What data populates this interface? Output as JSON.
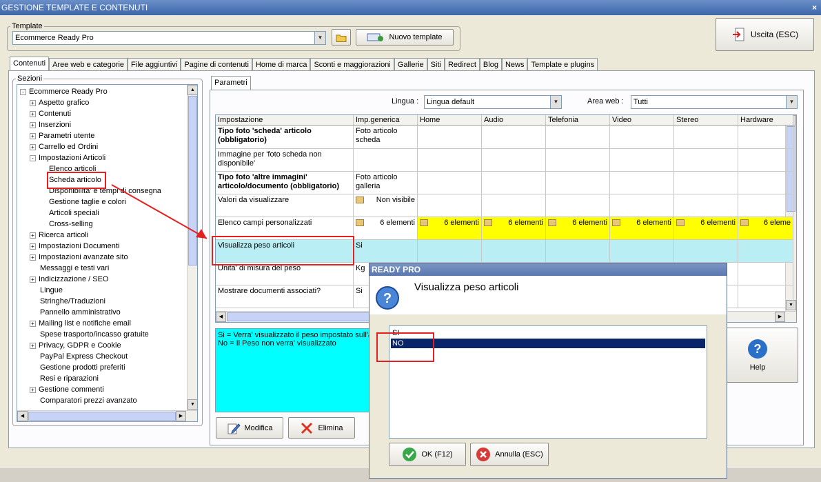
{
  "window": {
    "title": "GESTIONE TEMPLATE E CONTENUTI",
    "close_glyph": "×"
  },
  "template": {
    "group_label": "Template",
    "selected": "Ecommerce Ready Pro",
    "new_button": "Nuovo template"
  },
  "exit_button": "Uscita (ESC)",
  "tabs": [
    "Contenuti",
    "Aree web e categorie",
    "File aggiuntivi",
    "Pagine di contenuti",
    "Home di marca",
    "Sconti e maggiorazioni",
    "Gallerie",
    "Siti",
    "Redirect",
    "Blog",
    "News",
    "Template e plugins"
  ],
  "sections": {
    "label": "Sezioni",
    "root": "Ecommerce Ready Pro",
    "items": [
      {
        "label": "Aspetto grafico",
        "level": 1,
        "exp": "+"
      },
      {
        "label": "Contenuti",
        "level": 1,
        "exp": "+"
      },
      {
        "label": "Inserzioni",
        "level": 1,
        "exp": "+"
      },
      {
        "label": "Parametri utente",
        "level": 1,
        "exp": "+"
      },
      {
        "label": "Carrello ed Ordini",
        "level": 1,
        "exp": "+"
      },
      {
        "label": "Impostazioni Articoli",
        "level": 1,
        "exp": "-"
      },
      {
        "label": "Elenco articoli",
        "level": 2,
        "exp": ""
      },
      {
        "label": "Scheda articolo",
        "level": 2,
        "exp": ""
      },
      {
        "label": "Disponibilita' e tempi di consegna",
        "level": 2,
        "exp": ""
      },
      {
        "label": "Gestione taglie e colori",
        "level": 2,
        "exp": ""
      },
      {
        "label": "Articoli speciali",
        "level": 2,
        "exp": ""
      },
      {
        "label": "Cross-selling",
        "level": 2,
        "exp": ""
      },
      {
        "label": "Ricerca articoli",
        "level": 1,
        "exp": "+"
      },
      {
        "label": "Impostazioni Documenti",
        "level": 1,
        "exp": "+"
      },
      {
        "label": "Impostazioni avanzate sito",
        "level": 1,
        "exp": "+"
      },
      {
        "label": "Messaggi e testi vari",
        "level": 1,
        "exp": ""
      },
      {
        "label": "Indicizzazione / SEO",
        "level": 1,
        "exp": "+"
      },
      {
        "label": "Lingue",
        "level": 1,
        "exp": ""
      },
      {
        "label": "Stringhe/Traduzioni",
        "level": 1,
        "exp": ""
      },
      {
        "label": "Pannello amministrativo",
        "level": 1,
        "exp": ""
      },
      {
        "label": "Mailing list e notifiche email",
        "level": 1,
        "exp": "+"
      },
      {
        "label": "Spese trasporto/incasso gratuite",
        "level": 1,
        "exp": ""
      },
      {
        "label": "Privacy, GDPR e Cookie",
        "level": 1,
        "exp": "+"
      },
      {
        "label": "PayPal Express Checkout",
        "level": 1,
        "exp": ""
      },
      {
        "label": "Gestione prodotti preferiti",
        "level": 1,
        "exp": ""
      },
      {
        "label": "Resi e riparazioni",
        "level": 1,
        "exp": ""
      },
      {
        "label": "Gestione commenti",
        "level": 1,
        "exp": "+"
      },
      {
        "label": "Comparatori prezzi avanzato",
        "level": 1,
        "exp": ""
      }
    ]
  },
  "params": {
    "tab": "Parametri",
    "lingua_label": "Lingua :",
    "lingua_value": "Lingua default",
    "area_label": "Area web :",
    "area_value": "Tutti",
    "columns": [
      "Impostazione",
      "Imp.generica",
      "Home",
      "Audio",
      "Telefonia",
      "Video",
      "Stereo",
      "Hardware"
    ],
    "rows": [
      {
        "name": "Tipo foto 'scheda' articolo (obbligatorio)",
        "bold": true,
        "generic": "Foto articolo scheda"
      },
      {
        "name": "Immagine per 'foto scheda non disponibile'",
        "bold": false,
        "generic": ""
      },
      {
        "name": "Tipo foto 'altre immagini' articolo/documento (obbligatorio)",
        "bold": true,
        "generic": "Foto articolo galleria"
      },
      {
        "name": "Valori da visualizzare",
        "bold": false,
        "generic": "Non visibile"
      },
      {
        "name": "Elenco campi personalizzati",
        "bold": false,
        "generic": "6 elementi",
        "others": [
          "6 elementi",
          "6 elementi",
          "6 elementi",
          "6 elementi",
          "6 elementi",
          "6 eleme"
        ]
      },
      {
        "name": "Visualizza peso articoli",
        "bold": false,
        "generic": "Si"
      },
      {
        "name": "Unita' di misura del peso",
        "bold": false,
        "generic": "Kg"
      },
      {
        "name": "Mostrare documenti associati?",
        "bold": false,
        "generic": "Si"
      }
    ],
    "description": [
      "Si = Verra' visualizzato il peso impostato sull'ar",
      "No = Il Peso non verra' visualizzato"
    ],
    "modify_button": "Modifica",
    "delete_button": "Elimina",
    "help_button": "Help"
  },
  "dialog": {
    "title": "READY PRO",
    "question": "Visualizza peso articoli",
    "options": [
      "SI",
      "NO"
    ],
    "selected_index": 1,
    "ok_button": "OK (F12)",
    "cancel_button": "Annulla (ESC)"
  },
  "colors": {
    "highlight": "#e52020",
    "yellow": "#ffff00",
    "cyan": "#b8eef4",
    "selection": "#0a246a",
    "desc_bg": "#00ffff"
  }
}
